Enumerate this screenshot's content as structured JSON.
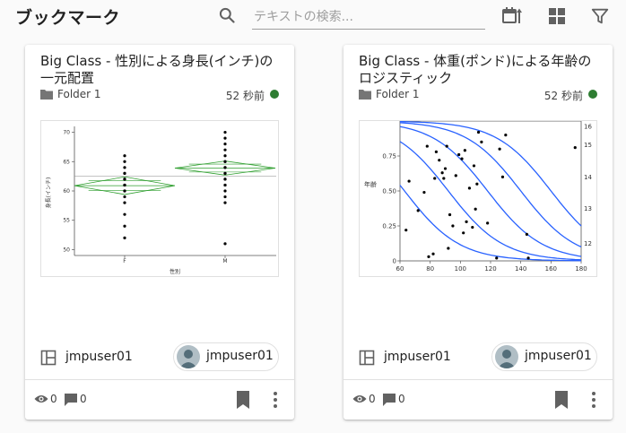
{
  "header": {
    "title": "ブックマーク",
    "search_placeholder": "テキストの検索...",
    "icons": [
      "search-icon",
      "sort-by-date-icon",
      "grid-view-icon",
      "filter-icon"
    ]
  },
  "cards": [
    {
      "title": "Big Class - 性別による身長(インチ)の一元配置",
      "folder": "Folder 1",
      "time_ago": "52 秒前",
      "status_color": "#2e7d32",
      "owner": "jmpuser01",
      "user_chip": "jmpuser01",
      "views": "0",
      "comments": "0",
      "chart_data": {
        "type": "scatter",
        "ylabel": "身長(インチ)",
        "xlabel": "性別",
        "categories": [
          "F",
          "M"
        ],
        "ylim": [
          49,
          71
        ],
        "yticks": [
          "70",
          "65",
          "60",
          "55",
          "50"
        ],
        "series": [
          {
            "category": "F",
            "values": [
              52,
              54,
              56,
              58,
              59,
              60,
              60,
              61,
              61,
              61,
              62,
              62,
              62,
              63,
              63,
              64,
              65,
              66
            ],
            "mean": 60.9,
            "ci": [
              59.4,
              62.4
            ]
          },
          {
            "category": "M",
            "values": [
              51,
              58,
              59,
              60,
              61,
              61,
              62,
              62,
              63,
              63,
              64,
              64,
              65,
              65,
              66,
              67,
              68,
              69,
              70
            ],
            "mean": 63.9,
            "ci": [
              62.7,
              65.1
            ]
          }
        ],
        "grand_mean": 62.5
      }
    },
    {
      "title": "Big Class - 体重(ポンド)による年齢のロジスティック",
      "folder": "Folder 1",
      "time_ago": "52 秒前",
      "status_color": "#2e7d32",
      "owner": "jmpuser01",
      "user_chip": "jmpuser01",
      "views": "0",
      "comments": "0",
      "chart_data": {
        "type": "line",
        "ylabel": "年齢",
        "xlim": [
          60,
          180
        ],
        "ylim": [
          0,
          1
        ],
        "xticks": [
          "60",
          "80",
          "100",
          "120",
          "140",
          "160",
          "180"
        ],
        "yticks": [
          "0",
          "0.25",
          "0.50",
          "0.75"
        ],
        "y2ticks": [
          "12",
          "13",
          "14",
          "15",
          "16"
        ],
        "curve_midpoints": [
          63,
          92,
          118,
          140,
          160
        ],
        "points": [
          [
            64,
            0.22
          ],
          [
            66,
            0.57
          ],
          [
            72,
            0.36
          ],
          [
            76,
            0.49
          ],
          [
            78,
            0.82
          ],
          [
            79,
            0.03
          ],
          [
            82,
            0.05
          ],
          [
            83,
            0.59
          ],
          [
            84,
            0.78
          ],
          [
            86,
            0.72
          ],
          [
            88,
            0.63
          ],
          [
            89,
            0.59
          ],
          [
            90,
            0.66
          ],
          [
            91,
            0.82
          ],
          [
            92,
            0.09
          ],
          [
            93,
            0.33
          ],
          [
            95,
            0.25
          ],
          [
            97,
            0.61
          ],
          [
            99,
            0.76
          ],
          [
            101,
            0.73
          ],
          [
            102,
            0.2
          ],
          [
            103,
            0.79
          ],
          [
            104,
            0.28
          ],
          [
            106,
            0.52
          ],
          [
            108,
            0.24
          ],
          [
            109,
            0.68
          ],
          [
            110,
            0.37
          ],
          [
            111,
            0.55
          ],
          [
            112,
            0.92
          ],
          [
            114,
            0.85
          ],
          [
            118,
            0.27
          ],
          [
            124,
            0.02
          ],
          [
            126,
            0.8
          ],
          [
            128,
            0.6
          ],
          [
            130,
            0.9
          ],
          [
            144,
            0.19
          ],
          [
            145,
            0.02
          ],
          [
            176,
            0.81
          ]
        ]
      }
    }
  ]
}
